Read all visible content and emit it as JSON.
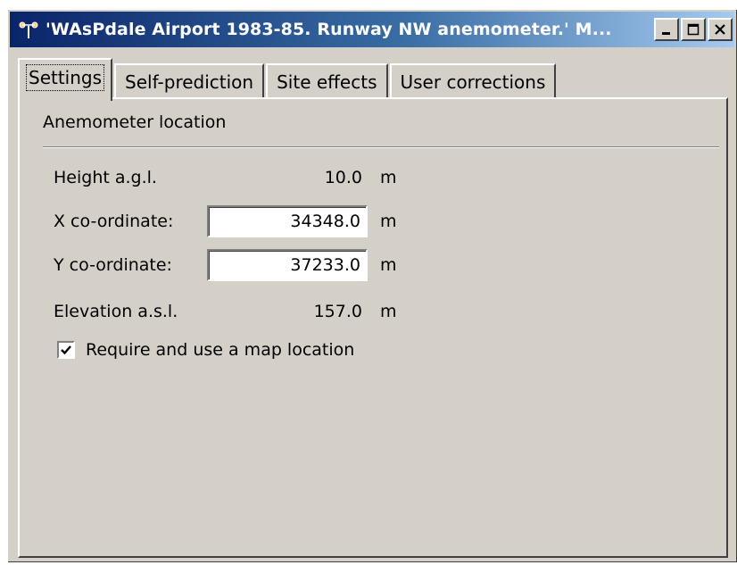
{
  "window": {
    "title": "'WAsPdale Airport 1983-85. Runway NW anemometer.' M...",
    "minimize_label": "_",
    "maximize_label": "□",
    "close_label": "✕"
  },
  "tabs": [
    {
      "label": "Settings",
      "active": true
    },
    {
      "label": "Self-prediction",
      "active": false
    },
    {
      "label": "Site effects",
      "active": false
    },
    {
      "label": "User corrections",
      "active": false
    }
  ],
  "group": {
    "label": "Anemometer location"
  },
  "fields": {
    "height": {
      "label": "Height a.g.l.",
      "value": "10.0",
      "unit": "m"
    },
    "x": {
      "label": "X co-ordinate:",
      "value": "34348.0",
      "unit": "m"
    },
    "y": {
      "label": "Y co-ordinate:",
      "value": "37233.0",
      "unit": "m"
    },
    "elevation": {
      "label": "Elevation a.s.l.",
      "value": "157.0",
      "unit": "m"
    }
  },
  "checkbox": {
    "label": "Require and use a map location",
    "checked": true
  }
}
